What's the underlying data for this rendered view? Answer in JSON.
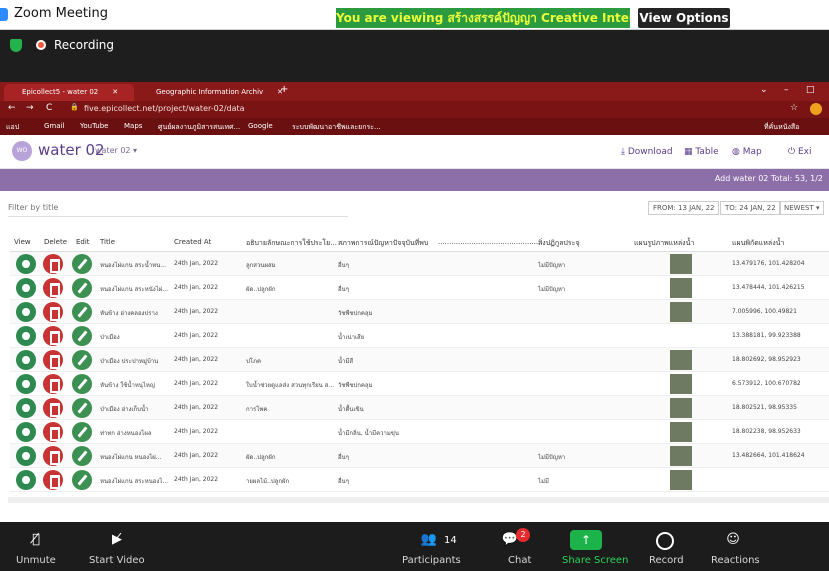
{
  "zoom": {
    "title": "Zoom Meeting",
    "banner": "You are viewing สร้างสรรค์ปัญญา Creative Intel...'s screen",
    "view_options": "View Options ⌄",
    "recording": "Recording",
    "bottom": {
      "unmute": "Unmute",
      "start_video": "Start Video",
      "participants": "Participants",
      "participants_count": "14",
      "chat": "Chat",
      "chat_badge": "2",
      "share_screen": "Share Screen",
      "record": "Record",
      "reactions": "Reactions"
    }
  },
  "browser": {
    "tabs": [
      {
        "label": "Epicollect5 - water 02"
      },
      {
        "label": "Geographic Information Archiv"
      }
    ],
    "url": "five.epicollect.net/project/water-02/data",
    "bookmarks": [
      "แอป",
      "Gmail",
      "YouTube",
      "Maps",
      "ศูนย์ผลงานภูมิสารสนเทศ...",
      "Google",
      "ระบบพัฒนาอาชีพและยกระ...",
      "ที่คั่นหนังสือ"
    ]
  },
  "app": {
    "project_badge": "WO",
    "project_name": "water 02",
    "project_sub": "water 02 ▾",
    "actions": {
      "download": "Download",
      "table": "Table",
      "map": "Map",
      "exit": "Exi"
    },
    "add_entry": "Add water 02   Total: 53,   1/2",
    "filter_placeholder": "Filter by title",
    "date_from": "FROM: 13 JAN, 22",
    "date_to": "TO: 24 JAN, 22",
    "sort": "NEWEST ▾",
    "columns": [
      "View",
      "Delete",
      "Edit",
      "Title",
      "Created At",
      "อธิบายลักษณะการใช้ประโย...",
      "สภาพการณ์ปัญหาปัจจุบันที่พบ",
      "...............................................",
      "สิ่งปฏิกูลประจุ",
      "แผนรูปภาพแหล่งน้ำ",
      "แผนพิกัดแหล่งน้ำ"
    ]
  },
  "rows": [
    {
      "title": "หนองไผ่แกน สระน้ำหน...",
      "created": "24th Jan, 2022",
      "use": "ลูกสวนผสม",
      "problem": "อื่นๆ",
      "pollution": "ไม่มีปัญหา",
      "photo": true,
      "coords": "13.479176, 101.428204"
    },
    {
      "title": "หนองไผ่แกน สระหนังไผ่...",
      "created": "24th Jan, 2022",
      "use": "ผัด..ปลูกผัก",
      "problem": "อื่นๆ",
      "pollution": "ไม่มีปัญหา",
      "photo": true,
      "coords": "13.478444, 101.426215"
    },
    {
      "title": "หันข้าง อ่างคลองปราง",
      "created": "24th Jan, 2022",
      "use": "",
      "problem": "วัชพืชปกคลุม",
      "pollution": "",
      "photo": true,
      "coords": "7.005996, 100.49821"
    },
    {
      "title": "ป่าเมือง",
      "created": "24th Jan, 2022",
      "use": "",
      "problem": "น้ำเน่าเสีย",
      "pollution": "",
      "photo": false,
      "coords": "13.388181, 99.923388"
    },
    {
      "title": "ป่าเมือง ประปาหมู่บ้าน",
      "created": "24th Jan, 2022",
      "use": "ปโภค",
      "problem": "น้ำมีสี",
      "pollution": "",
      "photo": true,
      "coords": "18.802692, 98.952923"
    },
    {
      "title": "หันข้าง ใช้น้ำหนุไหญ่",
      "created": "24th Jan, 2022",
      "use": "ใบน้ำช่วยดูแลส่ง สวนทุกเรียน ส...",
      "problem": "วัชพืชปกคลุม",
      "pollution": "",
      "photo": true,
      "coords": "6.573912, 100.670782"
    },
    {
      "title": "ป่าเมือง อ่างเก็บน้ำ",
      "created": "24th Jan, 2022",
      "use": "การโพค",
      "problem": "น้ำตื้นเขิน",
      "pollution": "",
      "photo": true,
      "coords": "18.802521, 98.95335"
    },
    {
      "title": "ท่าทก อ่างหนองไผล",
      "created": "24th Jan, 2022",
      "use": "",
      "problem": "น้ำมีกลิ่น, น้ำมีความขุ่น",
      "pollution": "",
      "photo": true,
      "coords": "18.802238, 98.952633"
    },
    {
      "title": "หนองไผ่แกน หนองไผ่...",
      "created": "24th Jan, 2022",
      "use": "ผัด..ปลูกผัก",
      "problem": "อื่นๆ",
      "pollution": "ไม่มีปัญหา",
      "photo": true,
      "coords": "13.482664, 101.418624"
    },
    {
      "title": "หนองไผ่แกน สระหนองไ...",
      "created": "24th Jan, 2022",
      "use": "ายผลไม้..ปลูกผัก",
      "problem": "อื่นๆ",
      "pollution": "ไม่มี",
      "photo": true,
      "coords": ""
    }
  ],
  "colors": {
    "banner_bg": "#2c9b3f",
    "browser_tab": "#8a1a1a",
    "brand_purple": "#5b3d8a",
    "purple_bar": "#8c6fa8",
    "view_btn": "#2f8a52",
    "delete_btn": "#c83333"
  }
}
